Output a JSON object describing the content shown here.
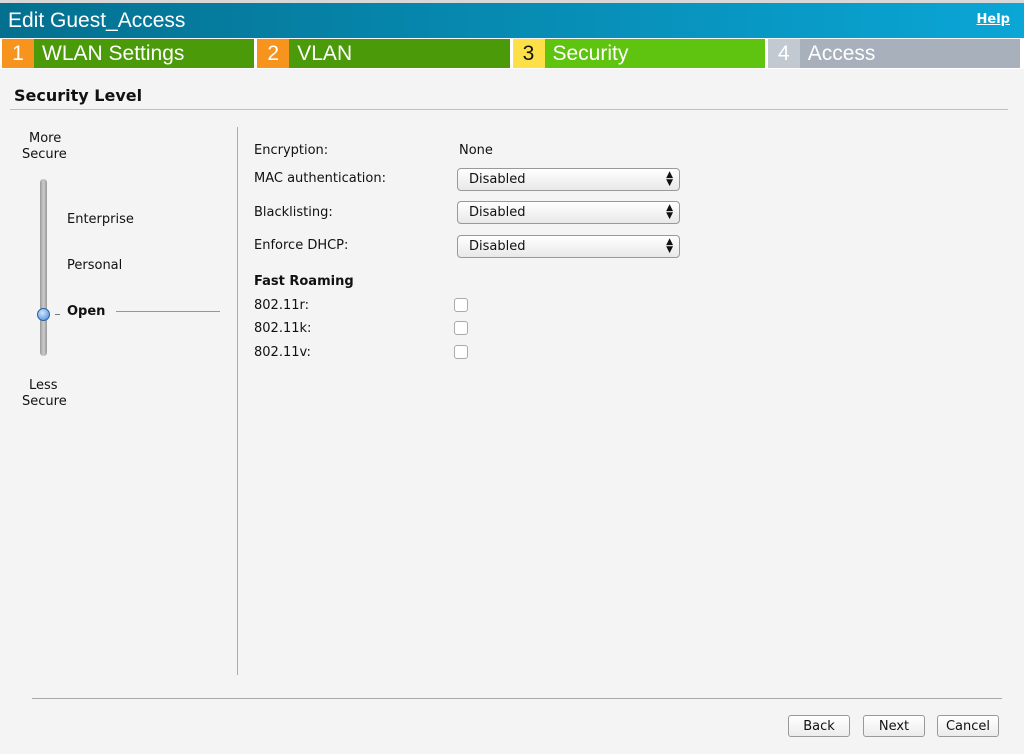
{
  "header": {
    "title": "Edit Guest_Access",
    "help": "Help"
  },
  "steps": [
    {
      "num": "1",
      "label": "WLAN Settings",
      "num_bg": "#f7941d",
      "bg": "#4a9a0a",
      "num_color": "#ffffff"
    },
    {
      "num": "2",
      "label": "VLAN",
      "num_bg": "#f7941d",
      "bg": "#4a9a0a",
      "num_color": "#ffffff"
    },
    {
      "num": "3",
      "label": "Security",
      "num_bg": "#fde047",
      "bg": "#5fc40f",
      "num_color": "#111111"
    },
    {
      "num": "4",
      "label": "Access",
      "num_bg": "#c3c9d1",
      "bg": "#a8b0bb",
      "num_color": "#ffffff"
    }
  ],
  "section_title": "Security Level",
  "slider": {
    "top_label": "More Secure",
    "top1": "More",
    "top2": "Secure",
    "bottom1": "Less",
    "bottom2": "Secure",
    "levels": [
      "Enterprise",
      "Personal",
      "Open"
    ],
    "selected": "Open"
  },
  "form": {
    "encryption_label": "Encryption:",
    "encryption_value": "None",
    "mac_label": "MAC authentication:",
    "mac_value": "Disabled",
    "blacklist_label": "Blacklisting:",
    "blacklist_value": "Disabled",
    "dhcp_label": "Enforce DHCP:",
    "dhcp_value": "Disabled",
    "fast_roaming": "Fast Roaming",
    "r_label": "802.11r:",
    "k_label": "802.11k:",
    "v_label": "802.11v:",
    "r_checked": false,
    "k_checked": false,
    "v_checked": false
  },
  "buttons": {
    "back": "Back",
    "next": "Next",
    "cancel": "Cancel"
  }
}
